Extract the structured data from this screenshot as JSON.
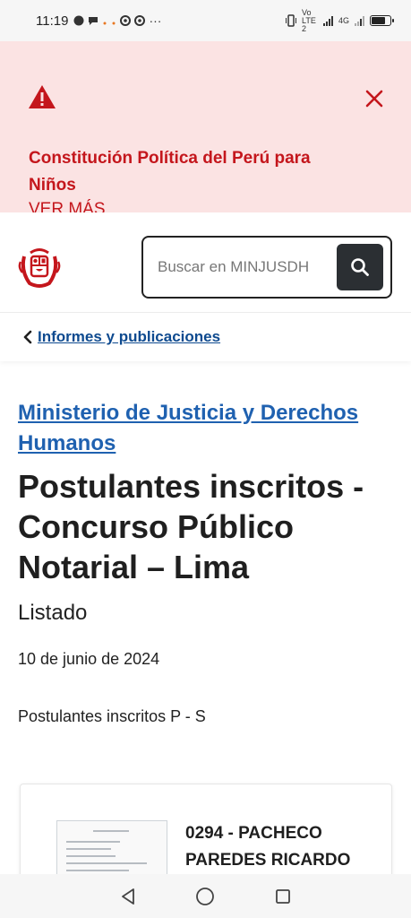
{
  "status": {
    "time": "11:19",
    "network": "Vo LTE 2",
    "net4g": "4G",
    "battery_level": 0.75
  },
  "alert": {
    "icon": "warning-triangle-icon",
    "title": "Constitución Política del Perú para Niños",
    "more": "VER MÁS",
    "close_icon": "close-icon",
    "color": "#c4161c",
    "bg": "#fbe3e3"
  },
  "header": {
    "logo": "peru-coat-of-arms-logo",
    "search_placeholder": "Buscar en MINJUSDH",
    "search_icon": "search-icon"
  },
  "breadcrumb": {
    "label": "Informes y publicaciones"
  },
  "main": {
    "org": "Ministerio de Justicia y Derechos Humanos",
    "title": "Postulantes inscritos - Concurso Público Notarial – Lima",
    "subtitle": "Listado",
    "date": "10 de junio de 2024",
    "description": "Postulantes inscritos P - S"
  },
  "card": {
    "title": "0294 - PACHECO PAREDES RICARDO"
  },
  "navbar": {
    "back_icon": "back-triangle-icon",
    "home_icon": "home-circle-icon",
    "recent_icon": "recent-apps-square-icon"
  }
}
